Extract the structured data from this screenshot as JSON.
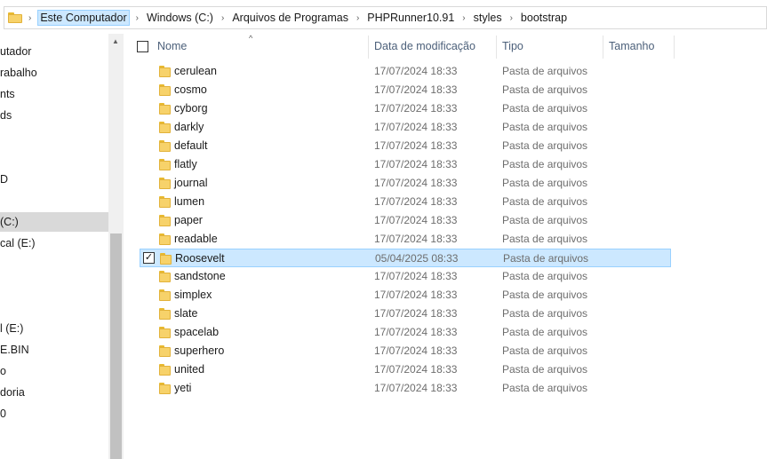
{
  "breadcrumbs": [
    "Este Computador",
    "Windows (C:)",
    "Arquivos de Programas",
    "PHPRunner10.91",
    "styles",
    "bootstrap"
  ],
  "nav": {
    "items": [
      "utador",
      "rabalho",
      "nts",
      "ds",
      "",
      "",
      "D",
      "",
      "(C:)",
      "cal (E:)",
      "",
      "",
      "",
      "l (E:)",
      "E.BIN",
      "o",
      "doria",
      "0",
      "",
      ""
    ],
    "selected_index": 8
  },
  "columns": {
    "name": "Nome",
    "date": "Data de modificação",
    "type": "Tipo",
    "size": "Tamanho"
  },
  "files": [
    {
      "name": "cerulean",
      "date": "17/07/2024 18:33",
      "type": "Pasta de arquivos"
    },
    {
      "name": "cosmo",
      "date": "17/07/2024 18:33",
      "type": "Pasta de arquivos"
    },
    {
      "name": "cyborg",
      "date": "17/07/2024 18:33",
      "type": "Pasta de arquivos"
    },
    {
      "name": "darkly",
      "date": "17/07/2024 18:33",
      "type": "Pasta de arquivos"
    },
    {
      "name": "default",
      "date": "17/07/2024 18:33",
      "type": "Pasta de arquivos"
    },
    {
      "name": "flatly",
      "date": "17/07/2024 18:33",
      "type": "Pasta de arquivos"
    },
    {
      "name": "journal",
      "date": "17/07/2024 18:33",
      "type": "Pasta de arquivos"
    },
    {
      "name": "lumen",
      "date": "17/07/2024 18:33",
      "type": "Pasta de arquivos"
    },
    {
      "name": "paper",
      "date": "17/07/2024 18:33",
      "type": "Pasta de arquivos"
    },
    {
      "name": "readable",
      "date": "17/07/2024 18:33",
      "type": "Pasta de arquivos"
    },
    {
      "name": "Roosevelt",
      "date": "05/04/2025 08:33",
      "type": "Pasta de arquivos",
      "selected": true
    },
    {
      "name": "sandstone",
      "date": "17/07/2024 18:33",
      "type": "Pasta de arquivos"
    },
    {
      "name": "simplex",
      "date": "17/07/2024 18:33",
      "type": "Pasta de arquivos"
    },
    {
      "name": "slate",
      "date": "17/07/2024 18:33",
      "type": "Pasta de arquivos"
    },
    {
      "name": "spacelab",
      "date": "17/07/2024 18:33",
      "type": "Pasta de arquivos"
    },
    {
      "name": "superhero",
      "date": "17/07/2024 18:33",
      "type": "Pasta de arquivos"
    },
    {
      "name": "united",
      "date": "17/07/2024 18:33",
      "type": "Pasta de arquivos"
    },
    {
      "name": "yeti",
      "date": "17/07/2024 18:33",
      "type": "Pasta de arquivos"
    }
  ],
  "colors": {
    "selection_bg": "#cce8ff",
    "selection_border": "#99d1ff",
    "header_text": "#4c607a",
    "meta_text": "#6d6d6d",
    "folder_yellow": "#f7d26a"
  }
}
